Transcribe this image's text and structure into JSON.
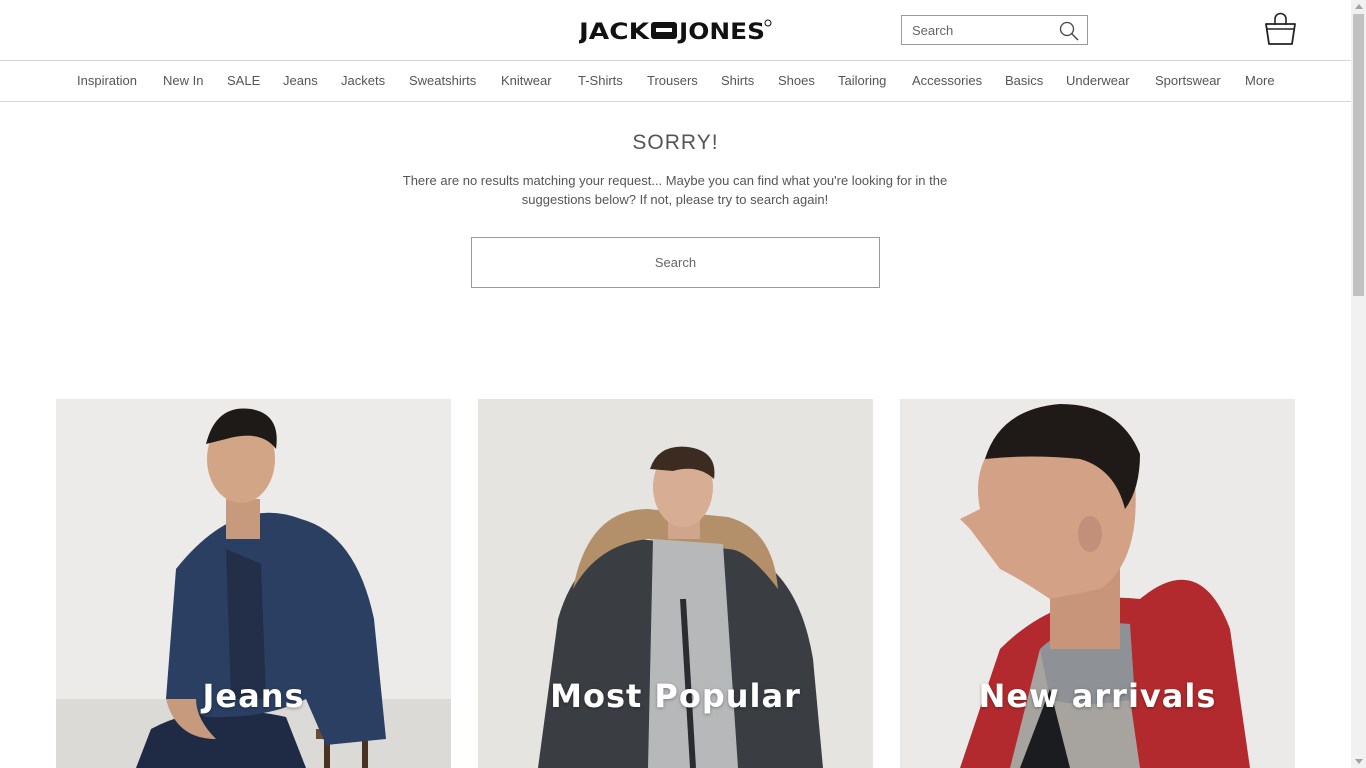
{
  "header": {
    "logo_text": "JACK&JONES",
    "search_placeholder": "Search",
    "icons": {
      "search": "search-icon",
      "basket": "basket-icon"
    }
  },
  "nav": {
    "items": [
      {
        "label": "Inspiration"
      },
      {
        "label": "New In"
      },
      {
        "label": "SALE"
      },
      {
        "label": "Jeans"
      },
      {
        "label": "Jackets"
      },
      {
        "label": "Sweatshirts"
      },
      {
        "label": "Knitwear"
      },
      {
        "label": "T-Shirts"
      },
      {
        "label": "Trousers"
      },
      {
        "label": "Shirts"
      },
      {
        "label": "Shoes"
      },
      {
        "label": "Tailoring"
      },
      {
        "label": "Accessories"
      },
      {
        "label": "Basics"
      },
      {
        "label": "Underwear"
      },
      {
        "label": "Sportswear"
      },
      {
        "label": "More"
      }
    ]
  },
  "main": {
    "title": "SORRY!",
    "message": "There are no results matching your request... Maybe you can find what you're looking for in the suggestions below? If not, please try to search again!",
    "search_placeholder": "Search"
  },
  "tiles": [
    {
      "label": "Jeans"
    },
    {
      "label": "Most Popular"
    },
    {
      "label": "New arrivals"
    }
  ],
  "colors": {
    "text": "#555555",
    "border": "#d6d6d6",
    "input_border": "#9a9a9a",
    "tile_label": "#ffffff",
    "denim": "#2b3f63",
    "parka": "#3a3d42",
    "red_jacket": "#b32a2e"
  }
}
